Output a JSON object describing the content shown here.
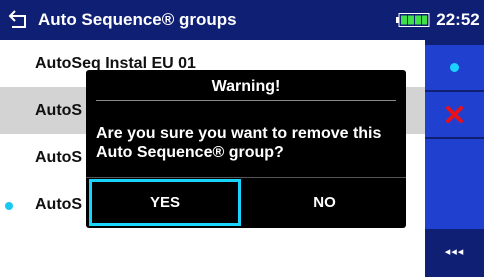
{
  "header": {
    "title": "Auto Sequence® groups",
    "time": "22:52",
    "back_icon": "back-arrow-icon",
    "battery_icon": "battery-full-icon"
  },
  "list": {
    "items": [
      {
        "label": "AutoSeq Instal EU 01",
        "selected": false,
        "marked": false
      },
      {
        "label": "AutoS",
        "selected": true,
        "marked": false
      },
      {
        "label": "AutoS",
        "selected": false,
        "marked": false
      },
      {
        "label": "AutoS",
        "selected": false,
        "marked": true
      }
    ]
  },
  "side_panel": {
    "buttons": [
      {
        "icon": "dot-icon",
        "color": "#19d4ff"
      },
      {
        "icon": "delete-x-icon",
        "color": "#e8101a"
      },
      {
        "icon": "blank",
        "color": "#2040cf"
      },
      {
        "icon": "more-options-icon",
        "label": "◂◂◂"
      }
    ]
  },
  "dialog": {
    "title": "Warning!",
    "message": "Are you sure you want to remove this Auto Sequence® group?",
    "yes_label": "YES",
    "no_label": "NO"
  },
  "colors": {
    "header_bg": "#0f1f73",
    "side_btn": "#2040cf",
    "accent": "#19d4ff",
    "selected_row": "#d3d3d3"
  }
}
